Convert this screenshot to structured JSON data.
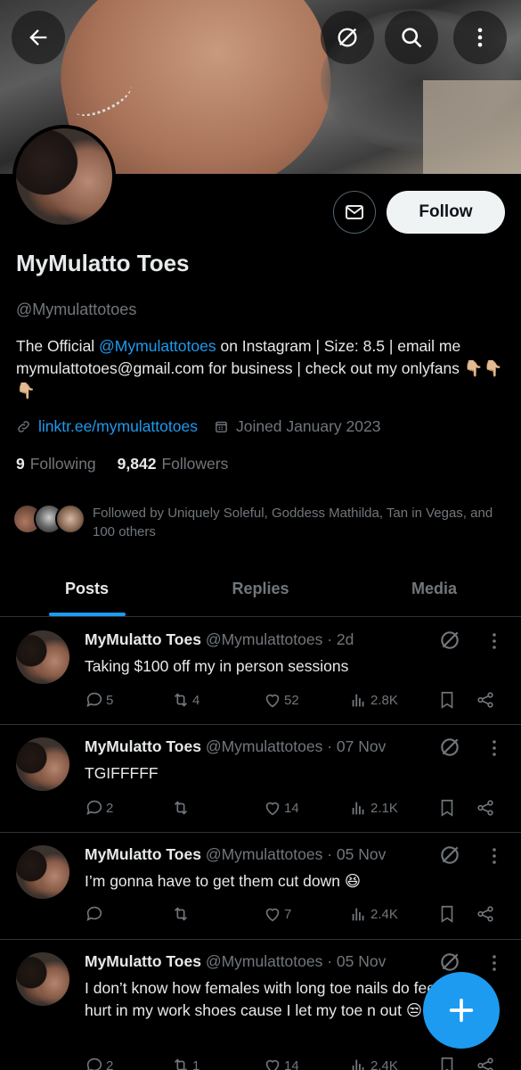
{
  "profile": {
    "name": "MyMulatto Toes",
    "handle": "@Mymulattotoes",
    "bio_prefix": "The Official ",
    "bio_mention": "@Mymulattotoes",
    "bio_suffix": " on Instagram | Size: 8.5 | email me mymulattotoes@gmail.com for business | check out my onlyfans 👇🏼👇🏼👇🏼",
    "link": "linktr.ee/mymulattotoes",
    "joined": "Joined January 2023",
    "following_count": "9",
    "following_label": "Following",
    "followers_count": "9,842",
    "followers_label": "Followers",
    "followed_by": "Followed by Uniquely Soleful, Goddess Mathilda, Tan in Vegas, and 100 others"
  },
  "buttons": {
    "follow": "Follow"
  },
  "tabs": [
    {
      "label": "Posts",
      "active": true
    },
    {
      "label": "Replies",
      "active": false
    },
    {
      "label": "Media",
      "active": false
    }
  ],
  "posts": [
    {
      "name": "MyMulatto Toes",
      "handle_date": "@Mymulattotoes · 2d",
      "text": "Taking $100 off my in person sessions",
      "replies": "5",
      "reposts": "4",
      "likes": "52",
      "views": "2.8K"
    },
    {
      "name": "MyMulatto Toes",
      "handle_date": "@Mymulattotoes · 07 Nov",
      "text": "TGIFFFFF",
      "replies": "2",
      "reposts": "",
      "likes": "14",
      "views": "2.1K"
    },
    {
      "name": "MyMulatto Toes",
      "handle_date": "@Mymulattotoes · 05 Nov",
      "text": "I’m gonna have to get them cut down 😆",
      "replies": "",
      "reposts": "",
      "likes": "7",
      "views": "2.4K"
    },
    {
      "name": "MyMulatto Toes",
      "handle_date": "@Mymulattotoes · 05 Nov",
      "text": "I don’t know how females with long toe nails do feet hurt in my work shoes cause I let my toe n out 😒",
      "replies": "2",
      "reposts": "1",
      "likes": "14",
      "views": "2.4K"
    }
  ],
  "colors": {
    "accent": "#1d9bf0",
    "background": "#000000",
    "muted": "#71767b",
    "text": "#e7e9ea"
  },
  "icons": [
    "back-arrow-icon",
    "grok-icon",
    "search-icon",
    "more-vertical-icon",
    "mail-icon",
    "link-icon",
    "calendar-icon",
    "reply-icon",
    "repost-icon",
    "like-icon",
    "views-icon",
    "bookmark-icon",
    "share-icon",
    "plus-icon"
  ]
}
